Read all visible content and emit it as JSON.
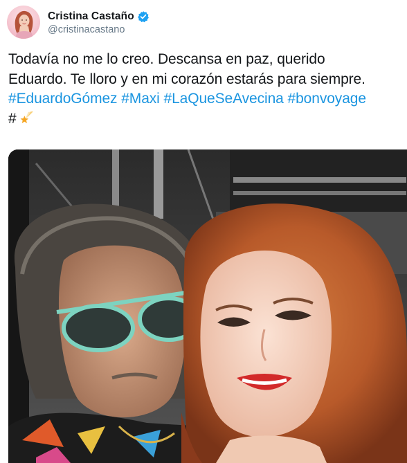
{
  "tweet": {
    "author": {
      "display_name": "Cristina Castaño",
      "handle": "@cristinacastano",
      "verified_icon": "verified-badge-icon",
      "avatar_icon": "profile-avatar"
    },
    "text_lines": [
      [
        {
          "t": "Todavía no me lo creo. Descansa en paz, querido",
          "tag": false
        }
      ],
      [
        {
          "t": "Eduardo. Te lloro y en mi corazón estarás para siempre.",
          "tag": false
        }
      ],
      [
        {
          "t": "#EduardoGómez",
          "tag": true
        },
        {
          "t": " ",
          "tag": false
        },
        {
          "t": "#Maxi",
          "tag": true
        },
        {
          "t": " ",
          "tag": false
        },
        {
          "t": "#LaQueSeAvecina",
          "tag": true
        },
        {
          "t": " ",
          "tag": false
        },
        {
          "t": "#bonvoyage",
          "tag": true
        }
      ],
      [
        {
          "t": "#",
          "tag": false
        }
      ]
    ],
    "trailing_emoji": "shooting-star-emoji",
    "media": {
      "kind": "photo",
      "icon": "selfie-photo"
    }
  },
  "colors": {
    "hashtag": "#1b95e0",
    "text": "#14171a",
    "secondary": "#657786",
    "verified": "#1da1f2"
  }
}
